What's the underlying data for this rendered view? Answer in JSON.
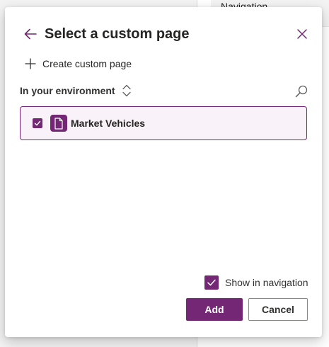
{
  "background": {
    "nav_label": "Navigation"
  },
  "dialog": {
    "title": "Select a custom page",
    "create_label": "Create custom page",
    "environment_label": "In your environment",
    "items": [
      {
        "label": "Market Vehicles",
        "checked": true,
        "icon": "page-icon"
      }
    ],
    "show_in_navigation": {
      "label": "Show in navigation",
      "checked": true
    },
    "add_label": "Add",
    "cancel_label": "Cancel"
  },
  "colors": {
    "accent": "#742774",
    "item_selected_bg": "#f9f2f8",
    "text": "#252423"
  }
}
